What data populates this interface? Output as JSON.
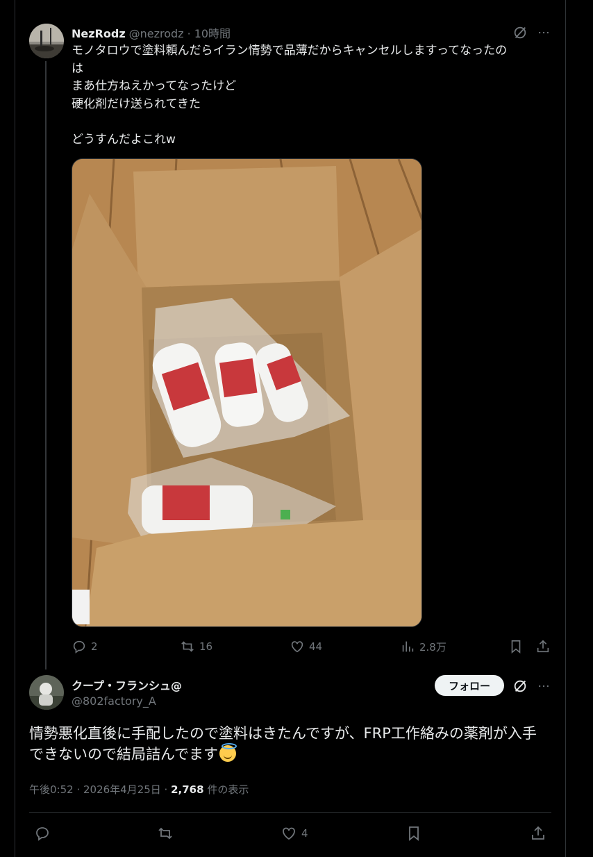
{
  "tweet1": {
    "display_name": "NezRodz",
    "handle": "@nezrodz",
    "separator": "·",
    "time": "10時間",
    "text": "モノタロウで塗料頼んだらイラン情勢で品薄だからキャンセルしますってなったの\nは\nまあ仕方ねえかってなったけど\n硬化剤だけ送られてきた\n\nどうすんだよこれw",
    "image_alt": "段ボール箱に入った硬化剤のボトル",
    "stats": {
      "replies": "2",
      "retweets": "16",
      "likes": "44",
      "views": "2.8万"
    }
  },
  "tweet2": {
    "display_name": "クープ・フランシュ@",
    "handle": "@802factory_A",
    "follow_label": "フォロー",
    "text": "情勢悪化直後に手配したので塗料はきたんですが、FRP工作絡みの薬剤が入手\nできないので結局詰んでます",
    "emoji": "smiling-face-with-halo",
    "timestamp": "午後0:52 · 2026年4月25日 · ",
    "views_count": "2,768",
    "views_label": " 件の表示",
    "stats": {
      "likes": "4"
    }
  },
  "icons": {
    "grok": "grok-icon",
    "more": "more-icon",
    "reply": "reply-icon",
    "retweet": "retweet-icon",
    "like": "like-icon",
    "views": "views-icon",
    "bookmark": "bookmark-icon",
    "share": "share-icon"
  },
  "colors": {
    "background": "#000000",
    "text": "#e7e9ea",
    "secondary": "#71767b",
    "border": "#2f3336"
  }
}
